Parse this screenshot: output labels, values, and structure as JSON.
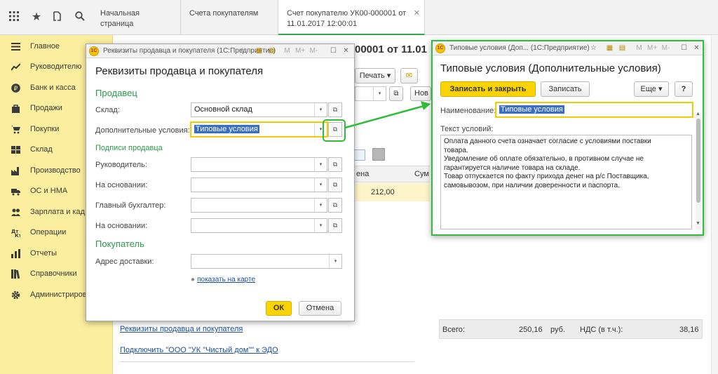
{
  "topbar": {
    "tabs": [
      {
        "label": "Начальная страница"
      },
      {
        "label": "Счета покупателям"
      },
      {
        "label_line1": "Счет покупателю УК00-000001 от",
        "label_line2": "11.01.2017 12:00:01"
      }
    ]
  },
  "sidebar": {
    "items": [
      {
        "label": "Главное",
        "icon": "menu-icon"
      },
      {
        "label": "Руководителю",
        "icon": "chart-icon"
      },
      {
        "label": "Банк и касса",
        "icon": "ruble-icon"
      },
      {
        "label": "Продажи",
        "icon": "bag-icon"
      },
      {
        "label": "Покупки",
        "icon": "cart-icon"
      },
      {
        "label": "Склад",
        "icon": "warehouse-icon"
      },
      {
        "label": "Производство",
        "icon": "factory-icon"
      },
      {
        "label": "ОС и НМА",
        "icon": "truck-icon"
      },
      {
        "label": "Зарплата и кад",
        "icon": "people-icon"
      },
      {
        "label": "Операции",
        "icon": "operations-icon"
      },
      {
        "label": "Отчеты",
        "icon": "report-icon"
      },
      {
        "label": "Справочники",
        "icon": "book-icon"
      },
      {
        "label": "Администриров",
        "icon": "gear-icon"
      }
    ]
  },
  "document": {
    "title_fragment": "00001 от 11.01",
    "print_button": "Печать",
    "new_button_fragment": "Нов",
    "col_price_fragment": "ена",
    "col_sum_fragment": "Сум",
    "row_price": "212,00",
    "link_requisites": "Реквизиты продавца и покупателя",
    "link_edo": "Подключить \"ООО \"УК \"Чистый дом\"\" к ЭДО",
    "total_label": "Всего:",
    "total_value": "250,16",
    "currency": "руб.",
    "vat_label": "НДС (в т.ч.):",
    "vat_value": "38,16"
  },
  "dialog_requisites": {
    "titlebar": "Реквизиты продавца и покупателя  (1С:Предприятие)",
    "heading": "Реквизиты продавца и покупателя",
    "section_seller": "Продавец",
    "warehouse_label": "Склад:",
    "warehouse_value": "Основной склад",
    "terms_label": "Дополнительные условия:",
    "terms_value": "Типовые условия",
    "signatures_section": "Подписи продавца",
    "head_label": "Руководитель:",
    "basis1_label": "На основании:",
    "accountant_label": "Главный бухгалтер:",
    "basis2_label": "На основании:",
    "section_buyer": "Покупатель",
    "address_label": "Адрес доставки:",
    "map_link": "показать на карте",
    "ok_button": "ОК",
    "cancel_button": "Отмена"
  },
  "dialog_terms": {
    "titlebar": "Типовые условия (Доп... (1С:Предприятие)",
    "heading": "Типовые условия (Дополнительные условия)",
    "save_close_button": "Записать и закрыть",
    "save_button": "Записать",
    "more_button": "Еще",
    "help_button": "?",
    "name_label": "Наименование:",
    "name_value": "Типовые условия",
    "text_label": "Текст условий:",
    "text_lines": [
      "Оплата данного счета означает согласие с условиями поставки",
      "товара.",
      "Уведомление об оплате обязательно, в противном случае не",
      "гарантируется наличие товара на складе.",
      "Товар отпускается по факту прихода денег на р/с Поставщика,",
      "самовывозом, при наличии доверенности и паспорта."
    ]
  },
  "colors": {
    "sidebar_bg": "#fbee9e",
    "accent_green": "#2fbd3a",
    "primary_button": "#fbd300",
    "section_green": "#2b9a4c"
  }
}
